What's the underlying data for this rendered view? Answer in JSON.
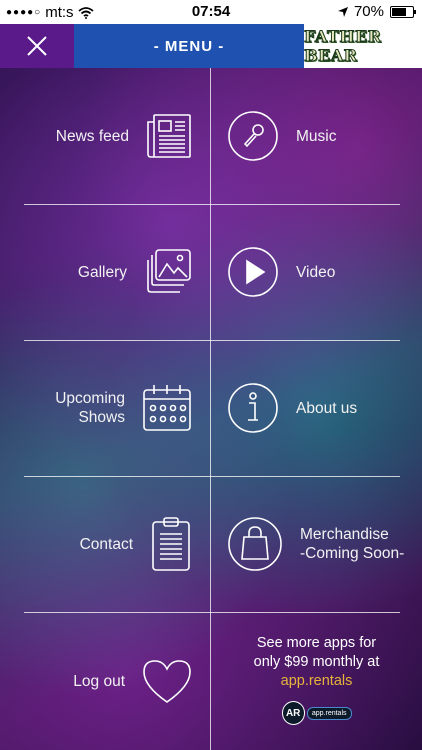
{
  "status_bar": {
    "signal_dots": "●●●●○",
    "carrier": "mt:s",
    "time": "07:54",
    "battery_percent": "70%",
    "battery_level": 0.7
  },
  "header": {
    "title": "- MENU -",
    "logo_text": "FATHER BEAR"
  },
  "menu": {
    "news_feed": "News feed",
    "music": "Music",
    "gallery": "Gallery",
    "video": "Video",
    "upcoming_line1": "Upcoming",
    "upcoming_line2": "Shows",
    "about_us": "About us",
    "contact": "Contact",
    "merch_line1": "Merchandise",
    "merch_line2": "-Coming Soon-",
    "log_out": "Log out"
  },
  "promo": {
    "line1": "See more apps for",
    "line2": "only $99 monthly at",
    "link": "app.rentals",
    "badge_letters": "AR",
    "badge_tag": "app.rentals"
  },
  "colors": {
    "close_bg": "#5a1a8a",
    "menu_bar_bg": "#1f52b0",
    "promo_link": "#e7b33a"
  }
}
